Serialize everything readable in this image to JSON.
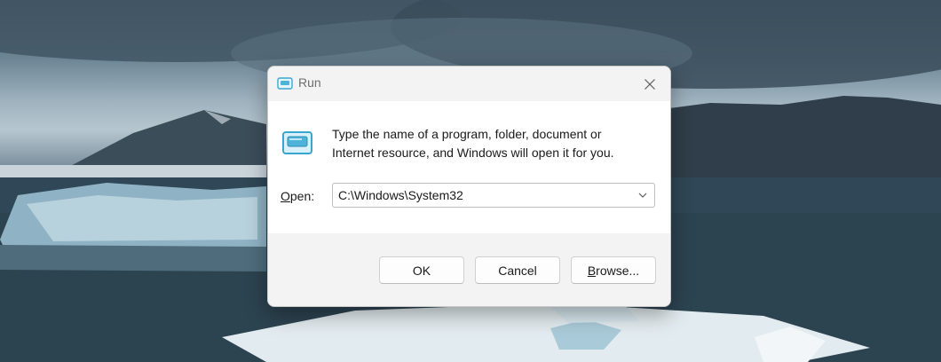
{
  "window": {
    "title": "Run",
    "icon": "run-icon",
    "close_icon": "close-icon"
  },
  "dialog": {
    "description_line1": "Type the name of a program, folder, document or",
    "description_line2": "Internet resource, and Windows will open it for you.",
    "open_label_mnemonic": "O",
    "open_label_rest": "pen:",
    "open_value": "C:\\Windows\\System32",
    "dropdown_icon": "chevron-down-icon"
  },
  "buttons": {
    "ok": "OK",
    "cancel": "Cancel",
    "browse_mnemonic": "B",
    "browse_rest": "rowse..."
  },
  "colors": {
    "accent_icon": "#4fb3d9",
    "titlebar": "#f3f3f3",
    "footer": "#f3f3f3"
  }
}
